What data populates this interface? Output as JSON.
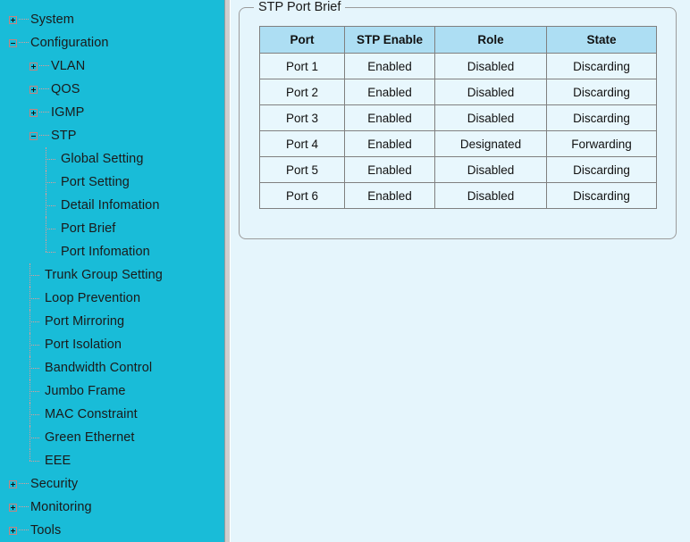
{
  "sidebar": {
    "items": [
      {
        "label": "System",
        "level": 0,
        "marker": "plus"
      },
      {
        "label": "Configuration",
        "level": 0,
        "marker": "minus"
      },
      {
        "label": "VLAN",
        "level": 1,
        "marker": "plus"
      },
      {
        "label": "QOS",
        "level": 1,
        "marker": "plus"
      },
      {
        "label": "IGMP",
        "level": 1,
        "marker": "plus"
      },
      {
        "label": "STP",
        "level": 1,
        "marker": "minus"
      },
      {
        "label": "Global Setting",
        "level": 2,
        "marker": "leaf"
      },
      {
        "label": "Port Setting",
        "level": 2,
        "marker": "leaf"
      },
      {
        "label": "Detail Infomation",
        "level": 2,
        "marker": "leaf"
      },
      {
        "label": "Port Brief",
        "level": 2,
        "marker": "leaf"
      },
      {
        "label": "Port Infomation",
        "level": 2,
        "marker": "leaf"
      },
      {
        "label": "Trunk Group Setting",
        "level": 1,
        "marker": "leaf"
      },
      {
        "label": "Loop Prevention",
        "level": 1,
        "marker": "leaf"
      },
      {
        "label": "Port Mirroring",
        "level": 1,
        "marker": "leaf"
      },
      {
        "label": "Port Isolation",
        "level": 1,
        "marker": "leaf"
      },
      {
        "label": "Bandwidth Control",
        "level": 1,
        "marker": "leaf"
      },
      {
        "label": "Jumbo Frame",
        "level": 1,
        "marker": "leaf"
      },
      {
        "label": "MAC Constraint",
        "level": 1,
        "marker": "leaf"
      },
      {
        "label": "Green Ethernet",
        "level": 1,
        "marker": "leaf"
      },
      {
        "label": "EEE",
        "level": 1,
        "marker": "leaf"
      },
      {
        "label": "Security",
        "level": 0,
        "marker": "plus"
      },
      {
        "label": "Monitoring",
        "level": 0,
        "marker": "plus"
      },
      {
        "label": "Tools",
        "level": 0,
        "marker": "plus"
      }
    ]
  },
  "panel": {
    "title": "STP Port Brief"
  },
  "table": {
    "columns": [
      "Port",
      "STP Enable",
      "Role",
      "State"
    ],
    "rows": [
      [
        "Port 1",
        "Enabled",
        "Disabled",
        "Discarding"
      ],
      [
        "Port 2",
        "Enabled",
        "Disabled",
        "Discarding"
      ],
      [
        "Port 3",
        "Enabled",
        "Disabled",
        "Discarding"
      ],
      [
        "Port 4",
        "Enabled",
        "Designated",
        "Forwarding"
      ],
      [
        "Port 5",
        "Enabled",
        "Disabled",
        "Discarding"
      ],
      [
        "Port 6",
        "Enabled",
        "Disabled",
        "Discarding"
      ]
    ]
  },
  "colors": {
    "sidebar_bg": "#19bcd8",
    "content_bg": "#e5f5fc",
    "table_header_bg": "#addef3",
    "table_cell_bg": "#e8f7fd",
    "table_border": "#808080",
    "panel_border": "#9b9b9b",
    "tree_marker_border": "#c4837f",
    "tree_connector": "#e49b97"
  }
}
